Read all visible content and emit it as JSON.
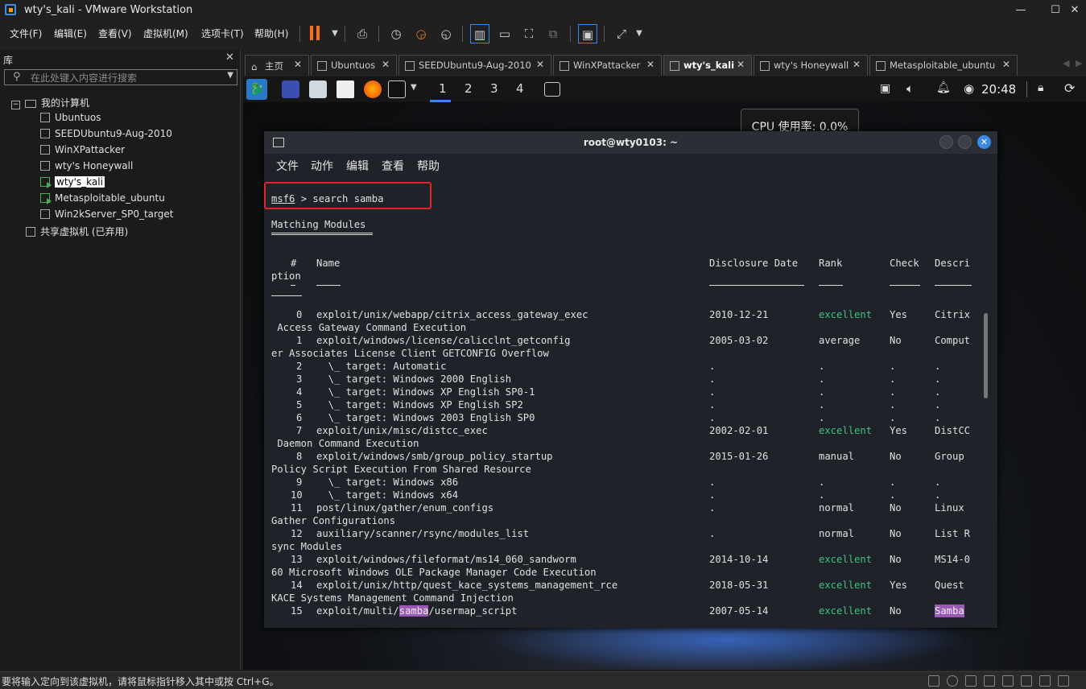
{
  "window": {
    "title": "wty's_kali - VMware Workstation",
    "min": "—",
    "max": "☐",
    "close": "✕"
  },
  "menu": [
    "文件(F)",
    "编辑(E)",
    "查看(V)",
    "虚拟机(M)",
    "选项卡(T)",
    "帮助(H)"
  ],
  "library": {
    "title": "库",
    "close": "✕",
    "search_placeholder": "在此处键入内容进行搜索",
    "root": "我的计算机",
    "items": [
      "Ubuntuos",
      "SEEDUbuntu9-Aug-2010",
      "WinXPattacker",
      "wty's Honeywall",
      "wty's_kali",
      "Metasploitable_ubuntu",
      "Win2kServer_SP0_target"
    ],
    "selected": "wty's_kali",
    "shared": "共享虚拟机 (已弃用)"
  },
  "tabs": [
    {
      "label": "主页"
    },
    {
      "label": "Ubuntuos"
    },
    {
      "label": "SEEDUbuntu9-Aug-2010"
    },
    {
      "label": "WinXPattacker"
    },
    {
      "label": "wty's_kali"
    },
    {
      "label": "wty's Honeywall"
    },
    {
      "label": "Metasploitable_ubuntu"
    }
  ],
  "tab_close": "✕",
  "guest_panel": {
    "workspaces": [
      "1",
      "2",
      "3",
      "4"
    ],
    "clock": "20:48"
  },
  "tooltip": "CPU 使用率: 0.0%",
  "terminal": {
    "title": "root@wty0103: ~",
    "menu": [
      "文件",
      "动作",
      "编辑",
      "查看",
      "帮助"
    ],
    "prompt": "msf6",
    "prompt_sep": " > ",
    "command": "search samba",
    "heading": "Matching Modules",
    "headers": {
      "num": "#",
      "name": "Name",
      "date": "Disclosure Date",
      "rank": "Rank",
      "check": "Check",
      "desc": "Descri",
      "desc_wrap": "ption"
    },
    "rows": [
      {
        "num": "0",
        "name": "exploit/unix/webapp/citrix_access_gateway_exec",
        "date": "2010-12-21",
        "rank": "excellent",
        "check": "Yes",
        "desc": "Citrix",
        "wrap": " Access Gateway Command Execution"
      },
      {
        "num": "1",
        "name": "exploit/windows/license/calicclnt_getconfig",
        "date": "2005-03-02",
        "rank": "average",
        "check": "No",
        "desc": "Comput",
        "wrap": "er Associates License Client GETCONFIG Overflow"
      },
      {
        "num": "2",
        "name": "  \\_ target: Automatic",
        "date": ".",
        "rank": ".",
        "check": ".",
        "desc": "."
      },
      {
        "num": "3",
        "name": "  \\_ target: Windows 2000 English",
        "date": ".",
        "rank": ".",
        "check": ".",
        "desc": "."
      },
      {
        "num": "4",
        "name": "  \\_ target: Windows XP English SP0-1",
        "date": ".",
        "rank": ".",
        "check": ".",
        "desc": "."
      },
      {
        "num": "5",
        "name": "  \\_ target: Windows XP English SP2",
        "date": ".",
        "rank": ".",
        "check": ".",
        "desc": "."
      },
      {
        "num": "6",
        "name": "  \\_ target: Windows 2003 English SP0",
        "date": ".",
        "rank": ".",
        "check": ".",
        "desc": "."
      },
      {
        "num": "7",
        "name": "exploit/unix/misc/distcc_exec",
        "date": "2002-02-01",
        "rank": "excellent",
        "check": "Yes",
        "desc": "DistCC",
        "wrap": " Daemon Command Execution"
      },
      {
        "num": "8",
        "name": "exploit/windows/smb/group_policy_startup",
        "date": "2015-01-26",
        "rank": "manual",
        "check": "No",
        "desc": "Group",
        "wrap": "Policy Script Execution From Shared Resource"
      },
      {
        "num": "9",
        "name": "  \\_ target: Windows x86",
        "date": ".",
        "rank": ".",
        "check": ".",
        "desc": "."
      },
      {
        "num": "10",
        "name": "  \\_ target: Windows x64",
        "date": ".",
        "rank": ".",
        "check": ".",
        "desc": "."
      },
      {
        "num": "11",
        "name": "post/linux/gather/enum_configs",
        "date": ".",
        "rank": "normal",
        "check": "No",
        "desc": "Linux",
        "wrap": "Gather Configurations"
      },
      {
        "num": "12",
        "name": "auxiliary/scanner/rsync/modules_list",
        "date": ".",
        "rank": "normal",
        "check": "No",
        "desc": "List R",
        "wrap": "sync Modules"
      },
      {
        "num": "13",
        "name": "exploit/windows/fileformat/ms14_060_sandworm",
        "date": "2014-10-14",
        "rank": "excellent",
        "check": "No",
        "desc": "MS14-0",
        "wrap": "60 Microsoft Windows OLE Package Manager Code Execution"
      },
      {
        "num": "14",
        "name": "exploit/unix/http/quest_kace_systems_management_rce",
        "date": "2018-05-31",
        "rank": "excellent",
        "check": "Yes",
        "desc": "Quest",
        "wrap": "KACE Systems Management Command Injection"
      },
      {
        "num": "15",
        "name_pre": "exploit/multi/",
        "name_hl": "samba",
        "name_post": "/usermap_script",
        "date": "2007-05-14",
        "rank": "excellent",
        "check": "No",
        "desc": "Samba"
      }
    ]
  },
  "statusbar": "要将输入定向到该虚拟机，请将鼠标指针移入其中或按 Ctrl+G。",
  "colors": {
    "accent": "#3a89e6",
    "highlight": "#9b59b6",
    "excellent": "#40c080",
    "annotation": "#e0242b",
    "pause": "#ff6a13"
  }
}
